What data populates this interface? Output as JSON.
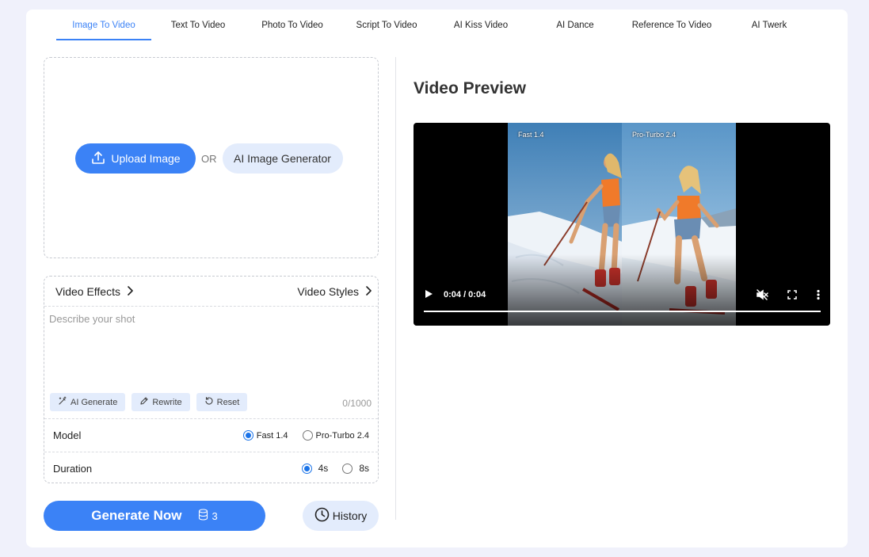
{
  "tabs": [
    {
      "label": "Image To Video",
      "active": true
    },
    {
      "label": "Text To Video",
      "active": false
    },
    {
      "label": "Photo To Video",
      "active": false
    },
    {
      "label": "Script To Video",
      "active": false
    },
    {
      "label": "AI Kiss Video",
      "active": false
    },
    {
      "label": "AI Dance",
      "active": false
    },
    {
      "label": "Reference To Video",
      "active": false
    },
    {
      "label": "AI Twerk",
      "active": false
    }
  ],
  "upload": {
    "upload_label": "Upload Image",
    "or_label": "OR",
    "ai_generator_label": "AI Image Generator"
  },
  "effects": {
    "video_effects_label": "Video Effects",
    "video_styles_label": "Video Styles"
  },
  "prompt": {
    "placeholder": "Describe your shot",
    "value": "",
    "counter": "0/1000",
    "ai_generate_label": "AI Generate",
    "rewrite_label": "Rewrite",
    "reset_label": "Reset"
  },
  "model": {
    "label": "Model",
    "options": [
      {
        "label": "Fast 1.4",
        "selected": true
      },
      {
        "label": "Pro-Turbo 2.4",
        "selected": false
      }
    ]
  },
  "duration": {
    "label": "Duration",
    "options": [
      {
        "label": "4s",
        "selected": true
      },
      {
        "label": "8s",
        "selected": false
      }
    ]
  },
  "actions": {
    "generate_label": "Generate Now",
    "credits": "3",
    "history_label": "History"
  },
  "preview": {
    "title": "Video Preview",
    "left_frame_label": "Fast 1.4",
    "right_frame_label": "Pro-Turbo 2.4",
    "time": "0:04 / 0:04",
    "progress": 1.0
  },
  "colors": {
    "accent": "#3b82f6",
    "accent_soft": "#e3ecfc",
    "page_background": "#f0f1fb"
  },
  "icons": [
    "upload-icon",
    "chevron-right-icon",
    "magic-wand-icon",
    "pencil-icon",
    "reset-icon",
    "coin-stack-icon",
    "clock-icon",
    "play-icon",
    "muted-icon",
    "fullscreen-icon",
    "more-vertical-icon"
  ]
}
